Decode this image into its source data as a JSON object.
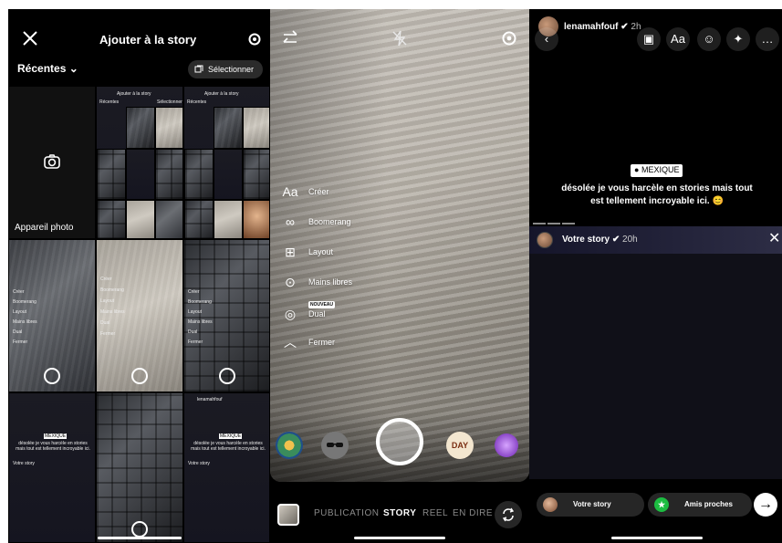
{
  "gallery": {
    "title": "Ajouter à la story",
    "recent_label": "Récentes",
    "select_label": "Sélectionner",
    "camera_label": "Appareil photo",
    "thumbs": {
      "title": "Ajouter à la story",
      "recent": "Récentes",
      "select": "Sélectionner",
      "camera": "Appareil photo",
      "create": "Créer",
      "boomerang": "Boomerang",
      "layout": "Layout",
      "hands_free": "Mains libres",
      "dual": "Dual",
      "close_menu": "Fermer",
      "caption": "désolée je vous harcèle en stories mais tout est tellement incroyable ici.",
      "location": "MEXIQUE",
      "your_story": "Votre story",
      "username": "lenamahfouf"
    }
  },
  "camera": {
    "menu": [
      {
        "icon": "Aa",
        "label": "Créer"
      },
      {
        "icon": "∞",
        "label": "Boomerang"
      },
      {
        "icon": "⊞",
        "label": "Layout"
      },
      {
        "icon": "⊙",
        "label": "Mains libres"
      },
      {
        "icon": "◎",
        "label": "Dual",
        "badge": "NOUVEAU"
      },
      {
        "icon": "︿",
        "label": "Fermer"
      }
    ],
    "modes": [
      "PUBLICATION",
      "STORY",
      "REEL",
      "EN DIRE"
    ],
    "active_mode": "STORY",
    "effect_badge": "DAY"
  },
  "story": {
    "username": "lenamahfouf",
    "time": "2h",
    "tool_text": "Aa",
    "location": "MEXIQUE",
    "caption": "désolée je vous harcèle en stories mais tout est tellement incroyable ici. 😊",
    "sheet_label": "Votre story",
    "sheet_time": "20h",
    "your_story_btn": "Votre story",
    "close_friends_btn": "Amis proches"
  },
  "colors": {
    "close_friends": "#1cbc41",
    "background": "#000000"
  }
}
